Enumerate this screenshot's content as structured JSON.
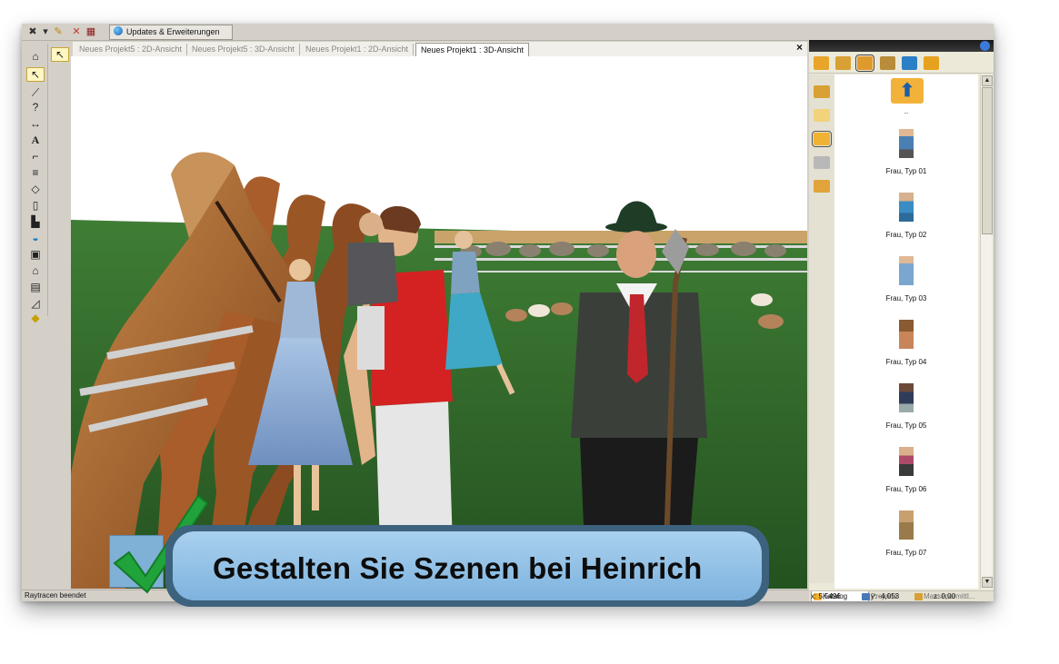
{
  "toolbar": {
    "update_button_label": "Updates & Erweiterungen"
  },
  "tabs": [
    {
      "label": "Neues Projekt5 : 2D-Ansicht"
    },
    {
      "label": "Neues Projekt5 : 3D-Ansicht"
    },
    {
      "label": "Neues Projekt1 : 2D-Ansicht"
    },
    {
      "label": "Neues Projekt1 : 3D-Ansicht"
    }
  ],
  "tab_close_glyph": "×",
  "catalog": {
    "parent_label": "..",
    "items": [
      {
        "label": "Frau, Typ 01"
      },
      {
        "label": "Frau, Typ 02"
      },
      {
        "label": "Frau, Typ 03"
      },
      {
        "label": "Frau, Typ 04"
      },
      {
        "label": "Frau, Typ 05"
      },
      {
        "label": "Frau, Typ 06"
      },
      {
        "label": "Frau, Typ 07"
      }
    ],
    "bottom_tabs": [
      {
        "label": "Katalog"
      },
      {
        "label": "Projekte"
      },
      {
        "label": "Massenermittl..."
      }
    ]
  },
  "status": {
    "text": "Raytracen beendet",
    "x": "x: 5,5496",
    "y": "y: -4,053",
    "z": "z: 0,00"
  },
  "banner": {
    "text": "Gestalten Sie Szenen bei Heinrich"
  },
  "colors": {
    "accent": "#1fa33a",
    "banner_fill": "#8fc0e6",
    "banner_border": "#3d627e",
    "grass": "#2f6a2a"
  },
  "icons": [
    "tools-icon",
    "wrench-icon",
    "delete-icon",
    "calculator-icon",
    "globe-icon",
    "arrow-up-folder-icon",
    "folder-icon",
    "person-icon"
  ]
}
